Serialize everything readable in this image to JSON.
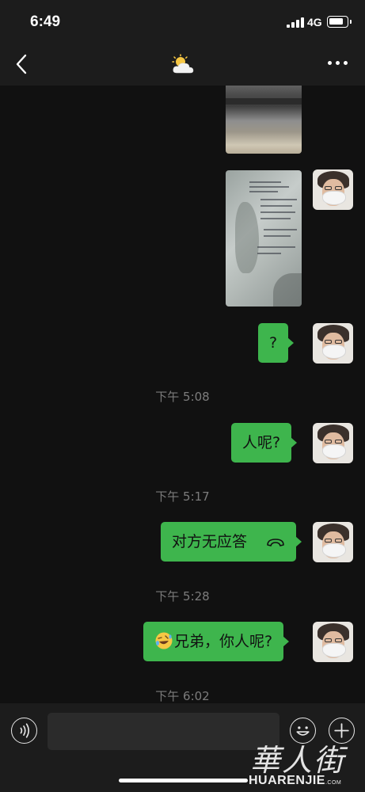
{
  "status_bar": {
    "time": "6:49",
    "network": "4G"
  },
  "header": {
    "title_icon": "sun-behind-cloud-icon"
  },
  "messages": [
    {
      "type": "image",
      "sender": "me",
      "icon": "photo-thumbnail"
    },
    {
      "type": "image",
      "sender": "me",
      "icon": "document-photo-thumbnail"
    },
    {
      "type": "text",
      "sender": "me",
      "text": "?"
    },
    {
      "type": "timestamp",
      "text": "下午 5:08"
    },
    {
      "type": "text",
      "sender": "me",
      "text": "人呢?"
    },
    {
      "type": "timestamp",
      "text": "下午 5:17"
    },
    {
      "type": "call",
      "sender": "me",
      "text": "对方无应答",
      "icon": "phone-hangup-icon"
    },
    {
      "type": "timestamp",
      "text": "下午 5:28"
    },
    {
      "type": "text",
      "sender": "me",
      "text": "兄弟，你人呢?",
      "emoji": "rolling-on-floor-laughing-icon"
    },
    {
      "type": "timestamp",
      "text": "下午 6:02"
    }
  ],
  "input_bar": {
    "placeholder": ""
  },
  "watermark": {
    "logo": "華人街",
    "text": "HUARENJIE",
    "suffix": ".COM"
  },
  "colors": {
    "bubble_green": "#3eb54d",
    "background": "#111111",
    "bar": "#1c1c1c"
  }
}
